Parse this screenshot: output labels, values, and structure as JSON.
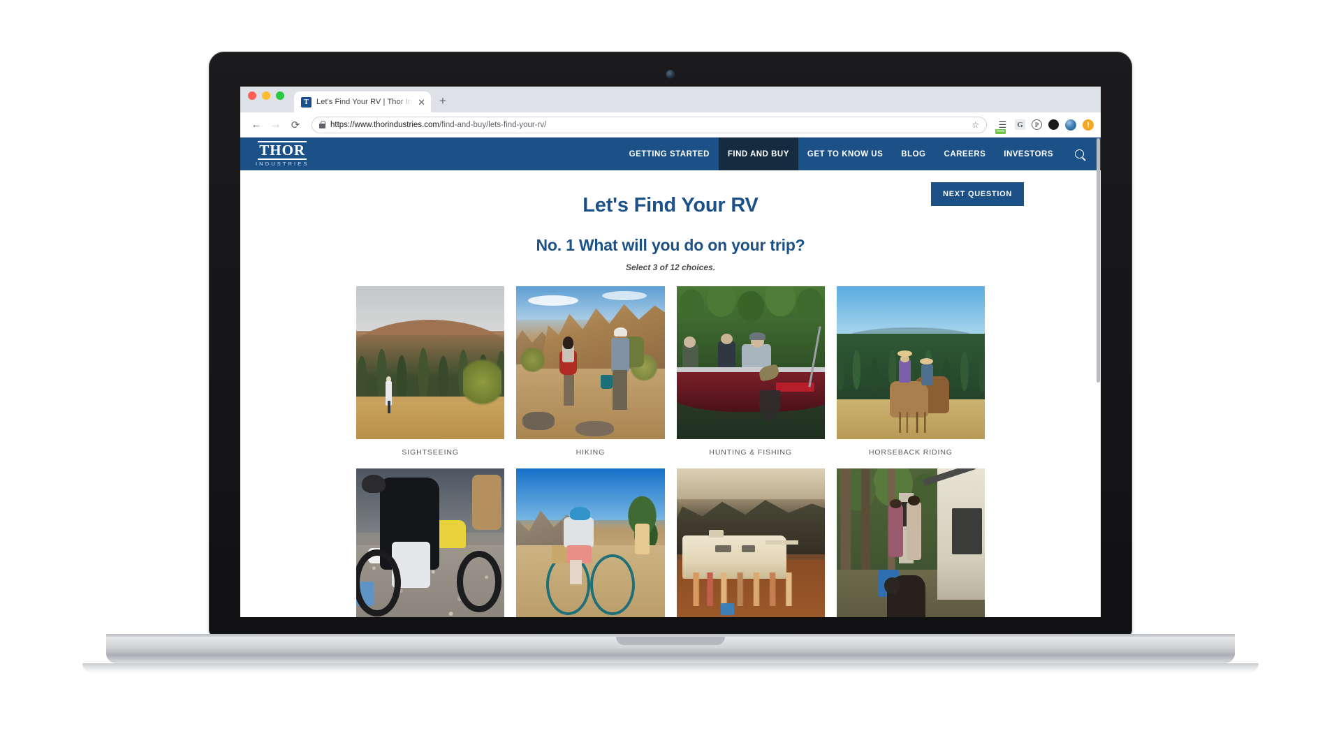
{
  "browser": {
    "tab": {
      "title": "Let's Find Your RV | Thor Indus",
      "favicon": "thor-favicon",
      "close_label": "✕"
    },
    "newtab_label": "+",
    "nav": {
      "back": "←",
      "forward": "→",
      "reload": "⟳"
    },
    "omnibox": {
      "lock": "secure-lock",
      "url_origin": "https://www.thorindustries.com",
      "url_path": "/find-and-buy/lets-find-your-rv/",
      "full_url": "https://www.thorindustries.com/find-and-buy/lets-find-your-rv/",
      "star": "☆"
    },
    "extensions": [
      {
        "name": "shopping-cart-extension-icon",
        "glyph": "⌑",
        "badge": "new"
      },
      {
        "name": "google-extension-icon",
        "glyph": "G",
        "badge": ""
      },
      {
        "name": "pinterest-extension-icon",
        "glyph": "P",
        "badge": ""
      },
      {
        "name": "dark-circle-extension-icon",
        "glyph": "",
        "badge": ""
      },
      {
        "name": "profile-avatar-icon",
        "glyph": "",
        "badge": ""
      },
      {
        "name": "warning-update-icon",
        "glyph": "!",
        "badge": ""
      }
    ]
  },
  "site": {
    "logo": {
      "name": "THOR",
      "subtitle": "INDUSTRIES"
    },
    "nav_items": [
      {
        "label": "GETTING STARTED",
        "active": false
      },
      {
        "label": "FIND AND BUY",
        "active": true
      },
      {
        "label": "GET TO KNOW US",
        "active": false
      },
      {
        "label": "BLOG",
        "active": false
      },
      {
        "label": "CAREERS",
        "active": false
      },
      {
        "label": "INVESTORS",
        "active": false
      }
    ],
    "search_icon": "search-icon"
  },
  "quiz": {
    "title": "Let's Find Your RV",
    "question": "No. 1 What will you do on your trip?",
    "instruction": "Select 3 of 12 choices.",
    "next_button": "NEXT QUESTION",
    "choices": [
      {
        "label": "SIGHTSEEING",
        "art": "p1",
        "selected": false
      },
      {
        "label": "HIKING",
        "art": "p2",
        "selected": false
      },
      {
        "label": "HUNTING & FISHING",
        "art": "p3",
        "selected": false
      },
      {
        "label": "HORSEBACK RIDING",
        "art": "p4",
        "selected": false
      },
      {
        "label": "",
        "art": "p5",
        "selected": false
      },
      {
        "label": "",
        "art": "p6",
        "selected": false
      },
      {
        "label": "",
        "art": "p7",
        "selected": false
      },
      {
        "label": "",
        "art": "p8",
        "selected": false
      }
    ]
  },
  "colors": {
    "brand_blue": "#1c5187",
    "nav_active": "#152b3f",
    "caption_gray": "#58585a"
  }
}
